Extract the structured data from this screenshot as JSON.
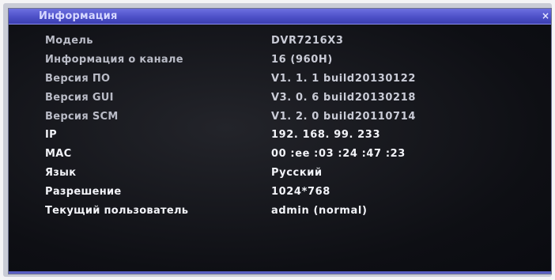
{
  "window": {
    "title": "Информация",
    "close_glyph": "×"
  },
  "rows": [
    {
      "label": "Модель",
      "value": "DVR7216X3"
    },
    {
      "label": "Информация о канале",
      "value": "16 (960H)"
    },
    {
      "label": "Версия ПО",
      "value": "V1. 1. 1 build20130122"
    },
    {
      "label": "Версия GUI",
      "value": "V3. 0. 6 build20130218"
    },
    {
      "label": "Версия SCM",
      "value": "V1. 2. 0 build20110714"
    },
    {
      "label": "IP",
      "value": "192. 168. 99. 233"
    },
    {
      "label": "MAC",
      "value": "00 :ee :03 :24 :47 :23"
    },
    {
      "label": "Язык",
      "value": "Русский"
    },
    {
      "label": "Разрешение",
      "value": "1024*768"
    },
    {
      "label": "Текущий пользователь",
      "value": "admin (normal)"
    }
  ],
  "colors": {
    "titlebar": "#4d50c8",
    "background": "#0e0f14",
    "text_dim": "#b9bbc6",
    "text_bright": "#f2f3f8"
  }
}
